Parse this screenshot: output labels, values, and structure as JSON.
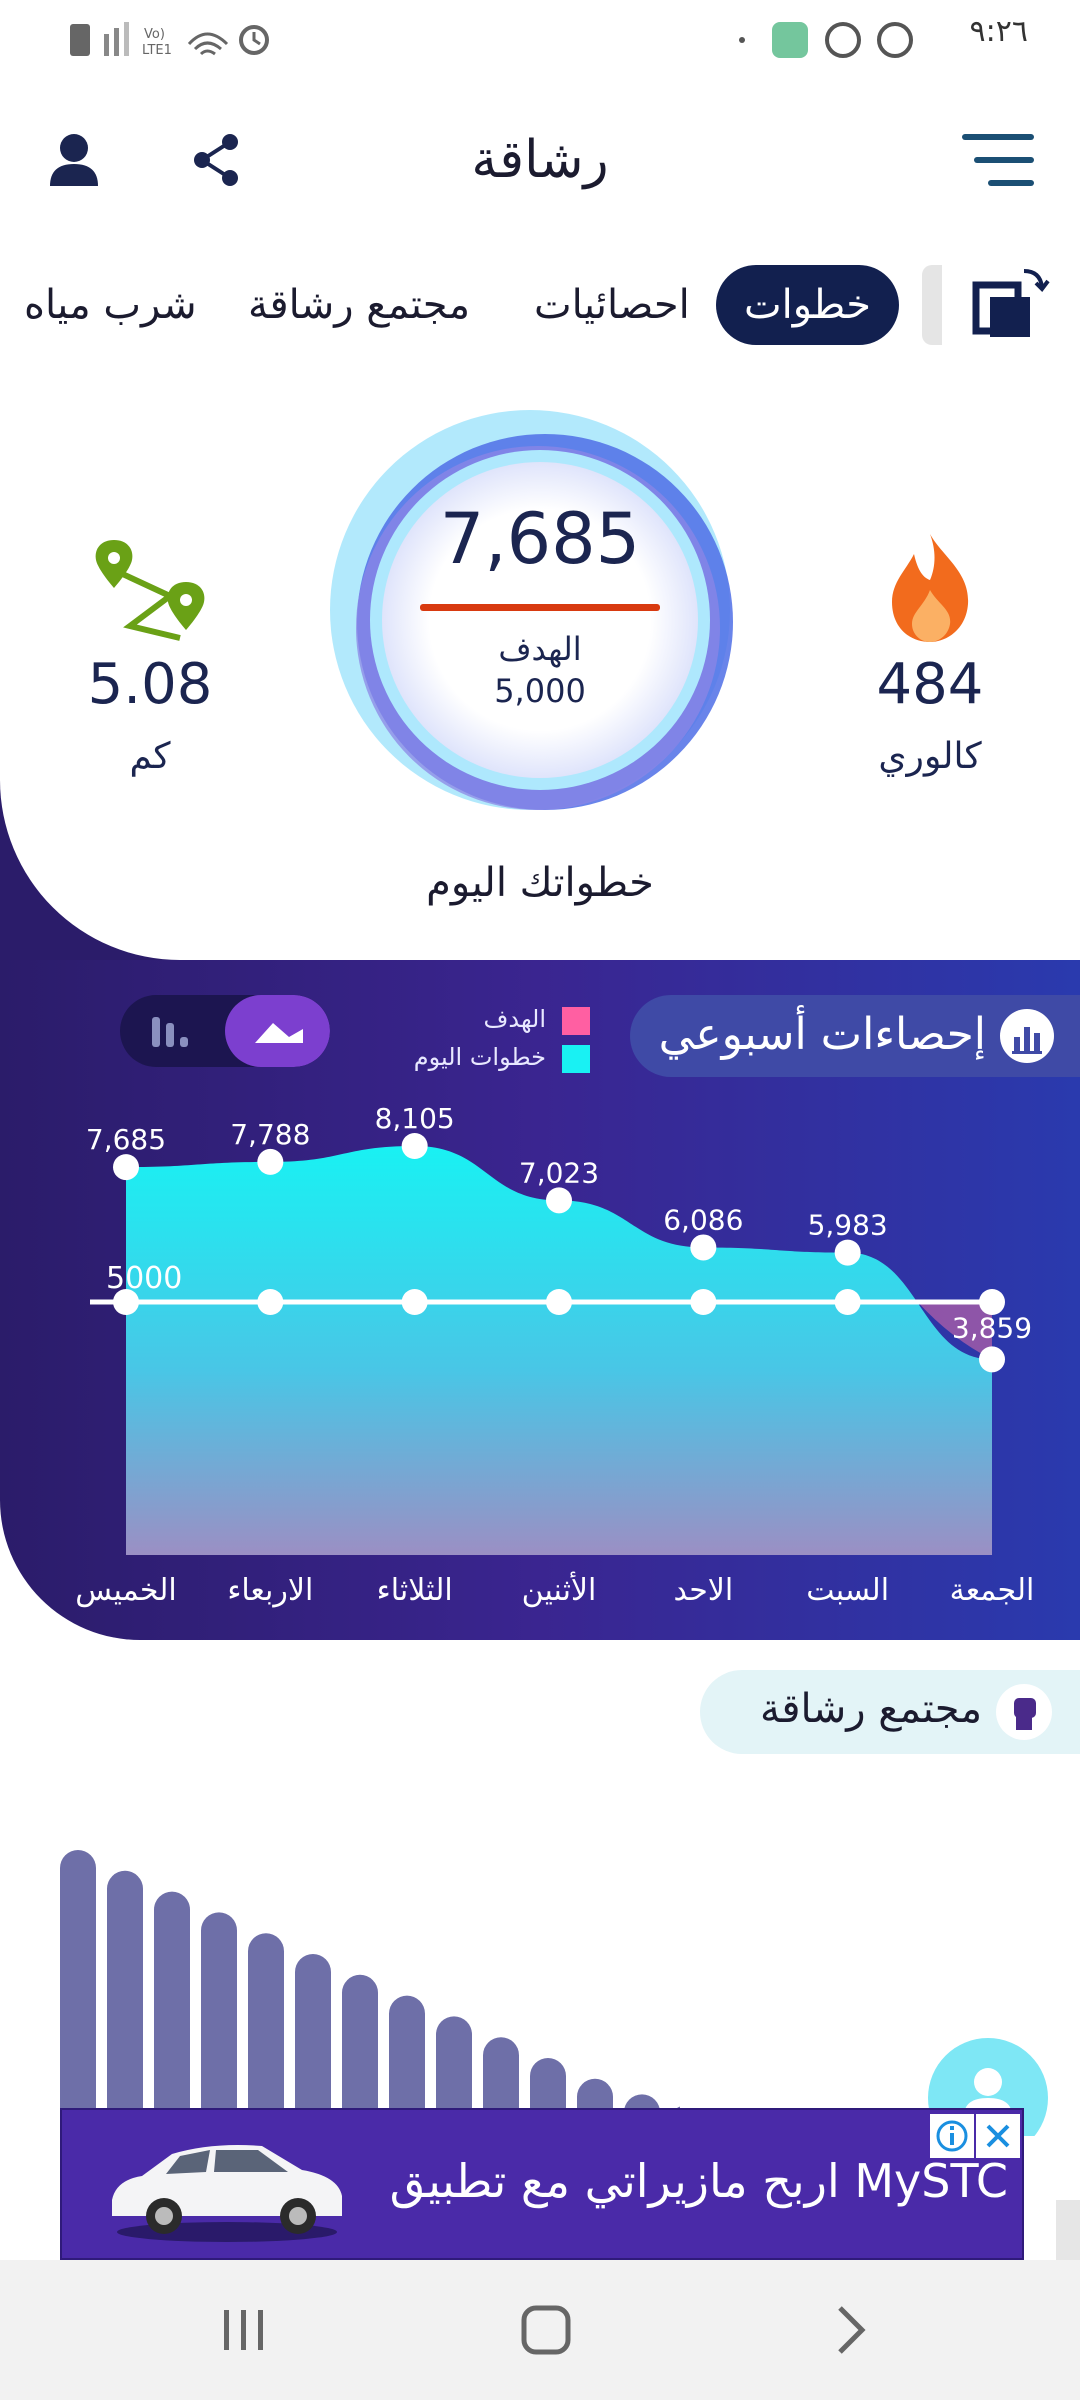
{
  "status_bar": {
    "time": "٩:٢٦"
  },
  "app_bar": {
    "title": "رشاقة"
  },
  "tabs": [
    {
      "label": "خطوات",
      "active": true
    },
    {
      "label": "احصائيات",
      "active": false
    },
    {
      "label": "مجتمع رشاقة",
      "active": false
    },
    {
      "label": "شرب مياه",
      "active": false
    }
  ],
  "today": {
    "steps": "7,685",
    "goal_label": "الهدف",
    "goal_value": "5,000",
    "caption": "خطواتك اليوم",
    "calories": "484",
    "calories_unit": "كالوري",
    "distance": "5.08",
    "distance_unit": "كم",
    "progress_fraction": 1.0
  },
  "weekly": {
    "title": "إحصاءات أسبوعي",
    "legend_goal": "الهدف",
    "legend_today": "خطوات اليوم",
    "goal_line_label": "5000"
  },
  "chart_data": {
    "type": "area",
    "categories": [
      "الخميس",
      "الاربعاء",
      "الثلاثاء",
      "الأثنين",
      "الاحد",
      "السبت",
      "الجمعة"
    ],
    "series": [
      {
        "name": "خطوات اليوم",
        "values": [
          7685,
          7788,
          8105,
          7023,
          6086,
          5983,
          3859
        ],
        "labels": [
          "7,685",
          "7,788",
          "8,105",
          "7,023",
          "6,086",
          "5,983",
          "3,859"
        ],
        "color": "#19f1f3"
      },
      {
        "name": "الهدف",
        "values": [
          5000,
          5000,
          5000,
          5000,
          5000,
          5000,
          5000
        ],
        "color": "#ffffff"
      }
    ],
    "ylim": [
      0,
      10000
    ],
    "grid": false,
    "legend": "top-center"
  },
  "community": {
    "title": "مجتمع رشاقة",
    "bar_values": [
      100,
      92,
      84,
      76,
      68,
      60,
      52,
      44,
      36,
      28,
      20,
      12,
      6,
      2
    ]
  },
  "ad": {
    "text": "اربح مازيراتي مع تطبيق MySTC"
  },
  "colors": {
    "primary": "#12204f",
    "accent": "#7c3fcf",
    "cyan": "#19f1f3",
    "goal_pink": "#ff5fa2"
  }
}
